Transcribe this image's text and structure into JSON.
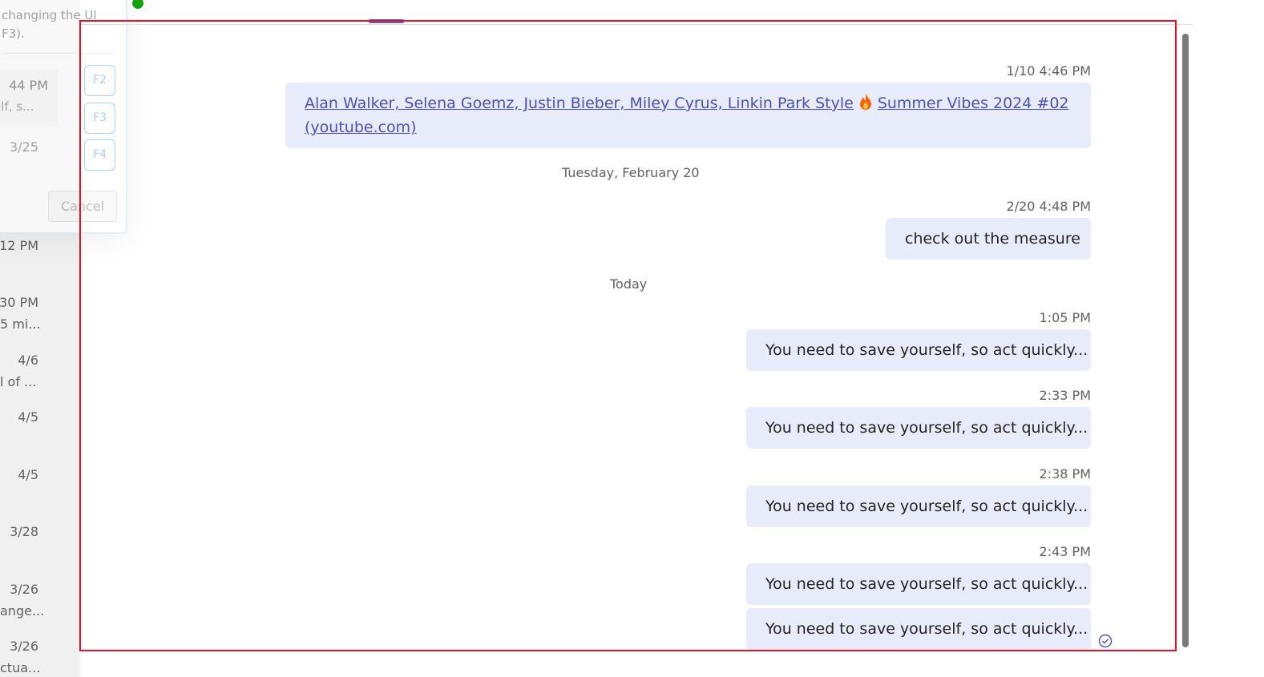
{
  "left_list": [
    {
      "time": "12 PM",
      "preview": ""
    },
    {
      "time": "30 PM",
      "preview": "5 mi..."
    },
    {
      "time": "4/6",
      "preview": "l of ..."
    },
    {
      "time": "4/5",
      "preview": ""
    },
    {
      "time": "4/5",
      "preview": ""
    },
    {
      "time": "3/28",
      "preview": ""
    },
    {
      "time": "3/26",
      "preview": "ange..."
    },
    {
      "time": "3/26",
      "preview": "ctua..."
    }
  ],
  "popup": {
    "description_line1": "changing the UI",
    "description_line2": "F3).",
    "card_time": "44 PM",
    "card_preview": "elf, s...",
    "date": "3/25",
    "keys": [
      "F2",
      "F3",
      "F4"
    ],
    "cancel_label": "Cancel"
  },
  "conversation": {
    "messages": [
      {
        "timestamp": "1/10 4:46 PM",
        "link_text_line1": "Alan Walker, Selena Goemz, Justin Bieber, Miley Cyrus, Linkin Park Style",
        "link_text_line1b": "Summer Vibes 2024 #02",
        "link_text_line2": "(youtube.com)"
      },
      {
        "date_divider": "Tuesday, February 20"
      },
      {
        "timestamp": "2/20 4:48 PM",
        "text": "check out the measure"
      },
      {
        "date_divider": "Today"
      },
      {
        "timestamp": "1:05 PM",
        "text": "You need to save yourself, so act quickly..."
      },
      {
        "timestamp": "2:33 PM",
        "text": "You need to save yourself, so act quickly..."
      },
      {
        "timestamp": "2:38 PM",
        "text": "You need to save yourself, so act quickly..."
      },
      {
        "timestamp": "2:43 PM",
        "text": "You need to save yourself, so act quickly..."
      },
      {
        "text": "You need to save yourself, so act quickly..."
      }
    ]
  },
  "icons": {
    "fire": "fire-emoji-icon",
    "read_receipt": "read-receipt-check-icon",
    "presence": "presence-available-icon"
  },
  "colors": {
    "bubble": "#e8ebfa",
    "link": "#4f52b2",
    "accent": "#5b5fc7",
    "selection": "#e81123",
    "presence": "#13a10e"
  }
}
